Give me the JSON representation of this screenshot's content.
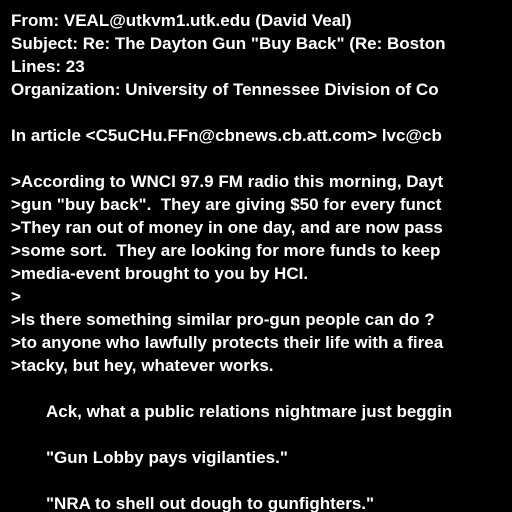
{
  "header": {
    "from": "From: VEAL@utkvm1.utk.edu (David Veal)",
    "subject": "Subject: Re: The Dayton Gun \"Buy Back\" (Re: Boston",
    "lines": "Lines: 23",
    "organization": "Organization: University of Tennessee Division of Co"
  },
  "body": {
    "attribution": "In article <C5uCHu.FFn@cbnews.cb.att.com> lvc@cb",
    "quoted": [
      ">According to WNCI 97.9 FM radio this morning, Dayt",
      ">gun \"buy back\".  They are giving $50 for every funct",
      ">They ran out of money in one day, and are now pass",
      ">some sort.  They are looking for more funds to keep",
      ">media-event brought to you by HCI.",
      ">",
      ">Is there something similar pro-gun people can do ?",
      ">to anyone who lawfully protects their life with a firea",
      ">tacky, but hey, whatever works."
    ],
    "reply": [
      "Ack, what a public relations nightmare just beggin",
      "\"Gun Lobby pays vigilanties.\"",
      "\"NRA to shell out dough to gunfighters.\""
    ]
  },
  "colors": {
    "background": "#000000",
    "text": "#ffffff"
  }
}
